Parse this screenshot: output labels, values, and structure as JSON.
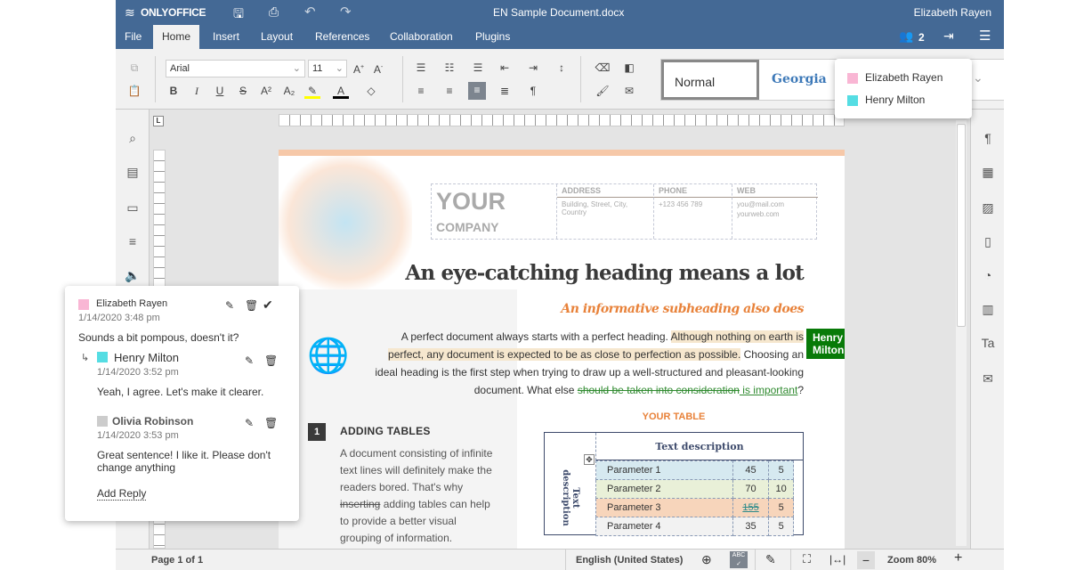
{
  "app": {
    "logo": "ONLYOFFICE",
    "doc_title": "EN Sample Document.docx",
    "user": "Elizabeth Rayen",
    "users_count": "2",
    "brand_color": "#446995"
  },
  "tabs": [
    "File",
    "Home",
    "Insert",
    "Layout",
    "References",
    "Collaboration",
    "Plugins"
  ],
  "toolbar": {
    "font": "Arial",
    "size": "11",
    "style_normal": "Normal",
    "style_georgia": "Georgia"
  },
  "users_popup": [
    {
      "name": "Elizabeth Rayen",
      "color": "#f9b6d4"
    },
    {
      "name": "Henry Milton",
      "color": "#55dde3"
    }
  ],
  "document": {
    "logo_your": "YOUR",
    "logo_company": "COMPANY",
    "contact": {
      "address_h": "ADDRESS",
      "address": "Building, Street, City, Country",
      "phone_h": "PHONE",
      "phone": "+123 456 789",
      "web_h": "WEB",
      "email": "you@mail.com",
      "web": "yourweb.com"
    },
    "heading": "An eye-catching heading means a lot",
    "subheading": "An informative subheading also does",
    "p1": "A perfect document always starts with a perfect heading. ",
    "p1_hl": "Although nothing on earth is perfect, any document is expected to be as close to perfection as possible.",
    "p2": " Choosing an ideal heading is the first step when trying to draw up a well-structured and pleasant-looking document. What else ",
    "p2_del": "should be taken into consideration",
    "p2_ins": " is important",
    "p2_end": "?",
    "cursor_tag": "Henry Milton",
    "section_num": "1",
    "section_title": "ADDING TABLES",
    "s_text1": "A document consisting of infinite text lines will definitely make the readers bored. That's why ",
    "s_del": "inserting",
    "s_text2": " adding tables can help to provide a better visual grouping of information.",
    "table_title": "YOUR TABLE",
    "table_head": "Text description",
    "table_side": "Text description",
    "table_rows": [
      [
        "Parameter 1",
        "45",
        "5"
      ],
      [
        "Parameter 2",
        "70",
        "10"
      ],
      [
        "Parameter 3",
        "155",
        "5"
      ],
      [
        "Parameter 4",
        "35",
        "5"
      ]
    ]
  },
  "comment": {
    "author": "Elizabeth Rayen",
    "author_color": "#f9b6d4",
    "date": "1/14/2020 3:48 pm",
    "text": "Sounds a bit pompous, doesn't it?",
    "replies": [
      {
        "author": "Henry Milton",
        "color": "#55dde3",
        "date": "1/14/2020 3:52 pm",
        "text": "Yeah, I agree. Let's make it clearer."
      },
      {
        "author": "Olivia Robinson",
        "color": "#cccccc",
        "date": "1/14/2020 3:53 pm",
        "text": "Great sentence! I like it. Please don't change anything"
      }
    ],
    "add_reply": "Add Reply"
  },
  "status": {
    "page": "Page 1 of 1",
    "language": "English (United States)",
    "zoom": "Zoom 80%"
  }
}
